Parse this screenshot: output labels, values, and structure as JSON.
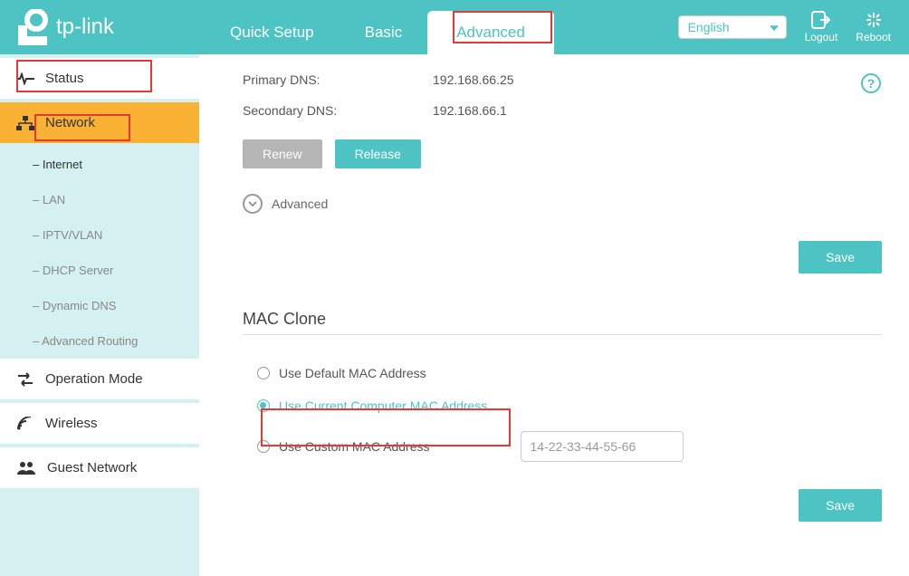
{
  "header": {
    "brand": "tp-link",
    "tabs": {
      "quick": "Quick Setup",
      "basic": "Basic",
      "advanced": "Advanced"
    },
    "language": "English",
    "logout": "Logout",
    "reboot": "Reboot"
  },
  "sidebar": {
    "status": "Status",
    "network": "Network",
    "sub": {
      "internet": "Internet",
      "lan": "LAN",
      "iptv": "IPTV/VLAN",
      "dhcp": "DHCP Server",
      "ddns": "Dynamic DNS",
      "routing": "Advanced Routing"
    },
    "opmode": "Operation Mode",
    "wireless": "Wireless",
    "guest": "Guest Network"
  },
  "dns": {
    "primary_label": "Primary DNS:",
    "primary_value": "192.168.66.25",
    "secondary_label": "Secondary DNS:",
    "secondary_value": "192.168.66.1"
  },
  "buttons": {
    "renew": "Renew",
    "release": "Release",
    "save": "Save",
    "advanced": "Advanced"
  },
  "mac": {
    "title": "MAC Clone",
    "opt_default": "Use Default MAC Address",
    "opt_current": "Use Current Computer MAC Address",
    "opt_custom": "Use Custom MAC Address",
    "custom_value": "14-22-33-44-55-66"
  }
}
